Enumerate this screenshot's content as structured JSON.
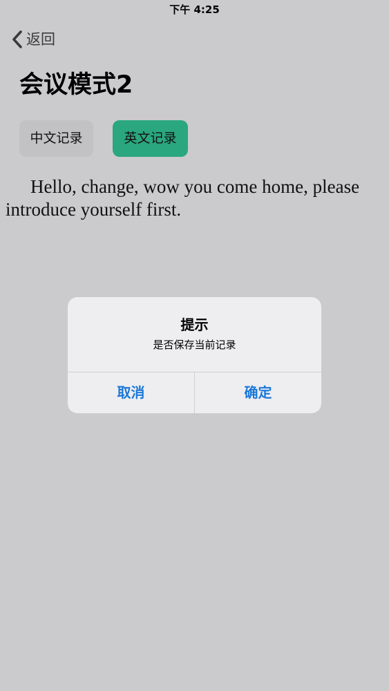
{
  "status_bar": {
    "time": "下午 4:25"
  },
  "nav": {
    "back_label": "返回",
    "back_icon": "chevron-left-icon"
  },
  "page": {
    "title": "会议模式2"
  },
  "tabs": [
    {
      "label": "中文记录",
      "selected": false
    },
    {
      "label": "英文记录",
      "selected": true
    }
  ],
  "transcript": {
    "text": "Hello, change, wow you come home, please introduce yourself first."
  },
  "dialog": {
    "title": "提示",
    "message": "是否保存当前记录",
    "cancel_label": "取消",
    "confirm_label": "确定"
  },
  "colors": {
    "background": "#cbcacd",
    "selected_tab": "#2aa77e",
    "unselected_tab": "#c2c1c4",
    "dialog_background": "#eeedf0",
    "dialog_button_text": "#1a78d8"
  }
}
